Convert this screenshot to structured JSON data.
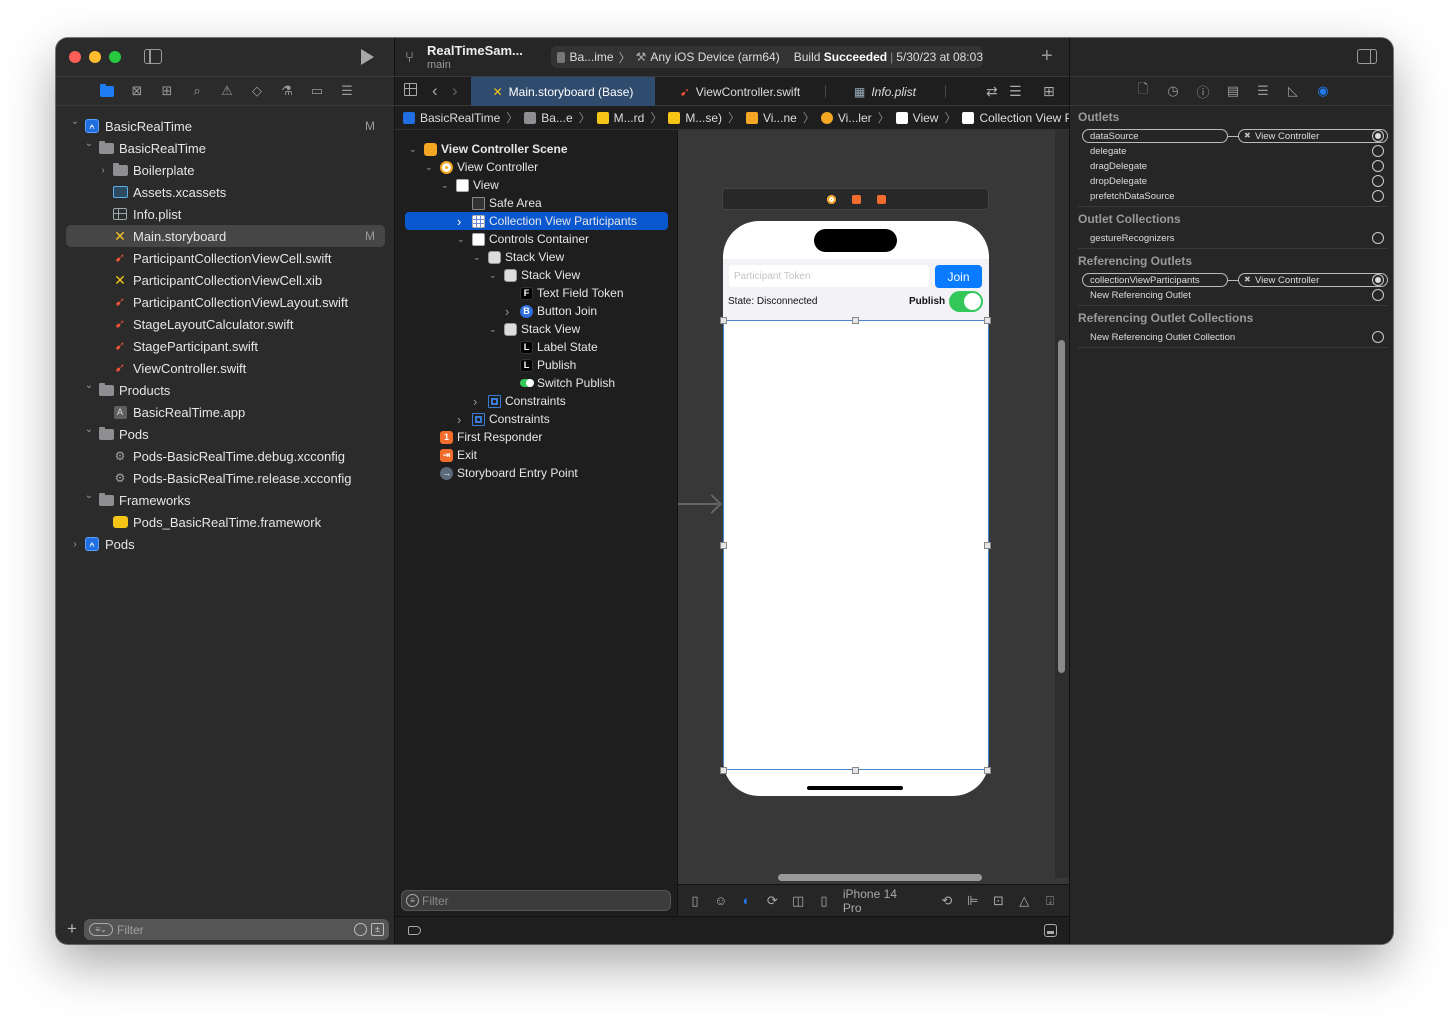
{
  "toolbar": {
    "project_name": "RealTimeSam...",
    "branch": "main",
    "scheme": "Ba...ime",
    "destination": "Any iOS Device (arm64)",
    "status_prefix": "Build",
    "status_bold": "Succeeded",
    "status_time": "5/30/23 at 08:03",
    "add_label": "+"
  },
  "navigator_tabs": [
    "folder-icon",
    "source-control-icon",
    "symbol-icon",
    "find-icon",
    "issue-icon",
    "test-icon",
    "debug-icon",
    "breakpoint-icon",
    "report-icon"
  ],
  "file_tree": [
    {
      "label": "BasicRealTime",
      "icon": "project",
      "level": 0,
      "chevron": "down",
      "badge": "M"
    },
    {
      "label": "BasicRealTime",
      "icon": "folder",
      "level": 1,
      "chevron": "down"
    },
    {
      "label": "Boilerplate",
      "icon": "folder",
      "level": 2,
      "chevron": "right"
    },
    {
      "label": "Assets.xcassets",
      "icon": "assets",
      "level": 2
    },
    {
      "label": "Info.plist",
      "icon": "plist",
      "level": 2
    },
    {
      "label": "Main.storyboard",
      "icon": "storyboard",
      "level": 2,
      "badge": "M",
      "selected": true
    },
    {
      "label": "ParticipantCollectionViewCell.swift",
      "icon": "swift",
      "level": 2
    },
    {
      "label": "ParticipantCollectionViewCell.xib",
      "icon": "storyboard",
      "level": 2
    },
    {
      "label": "ParticipantCollectionViewLayout.swift",
      "icon": "swift",
      "level": 2
    },
    {
      "label": "StageLayoutCalculator.swift",
      "icon": "swift",
      "level": 2
    },
    {
      "label": "StageParticipant.swift",
      "icon": "swift",
      "level": 2
    },
    {
      "label": "ViewController.swift",
      "icon": "swift",
      "level": 2
    },
    {
      "label": "Products",
      "icon": "folder",
      "level": 1,
      "chevron": "down"
    },
    {
      "label": "BasicRealTime.app",
      "icon": "app",
      "level": 2
    },
    {
      "label": "Pods",
      "icon": "folder",
      "level": 1,
      "chevron": "down"
    },
    {
      "label": "Pods-BasicRealTime.debug.xcconfig",
      "icon": "config",
      "level": 2
    },
    {
      "label": "Pods-BasicRealTime.release.xcconfig",
      "icon": "config",
      "level": 2
    },
    {
      "label": "Frameworks",
      "icon": "folder",
      "level": 1,
      "chevron": "down"
    },
    {
      "label": "Pods_BasicRealTime.framework",
      "icon": "framework",
      "level": 2
    },
    {
      "label": "Pods",
      "icon": "project",
      "level": 0,
      "chevron": "right"
    }
  ],
  "navigator_filter": {
    "placeholder": "Filter"
  },
  "tabs": [
    {
      "label": "Main.storyboard (Base)",
      "icon": "storyboard",
      "active": true
    },
    {
      "label": "ViewController.swift",
      "icon": "swift"
    },
    {
      "label": "Info.plist",
      "icon": "plist"
    }
  ],
  "jumpbar": [
    "BasicRealTime",
    "Ba...e",
    "M...rd",
    "M...se)",
    "Vi...ne",
    "Vi...ler",
    "View",
    "Collection View Participants"
  ],
  "outline": [
    {
      "label": "View Controller Scene",
      "icon": "scene",
      "level": 0,
      "chevron": "down",
      "bold": true
    },
    {
      "label": "View Controller",
      "icon": "vc",
      "level": 1,
      "chevron": "down"
    },
    {
      "label": "View",
      "icon": "view",
      "level": 2,
      "chevron": "down"
    },
    {
      "label": "Safe Area",
      "icon": "safe",
      "level": 3
    },
    {
      "label": "Collection View Participants",
      "icon": "collection",
      "level": 3,
      "chevron": "right",
      "selected": true
    },
    {
      "label": "Controls Container",
      "icon": "view",
      "level": 3,
      "chevron": "down"
    },
    {
      "label": "Stack View",
      "icon": "stack",
      "level": 4,
      "chevron": "down"
    },
    {
      "label": "Stack View",
      "icon": "stack",
      "level": 5,
      "chevron": "down"
    },
    {
      "label": "Text Field Token",
      "icon": "textfield",
      "glyph": "F",
      "level": 6
    },
    {
      "label": "Button Join",
      "icon": "button",
      "glyph": "B",
      "level": 6,
      "chevron": "right"
    },
    {
      "label": "Stack View",
      "icon": "stack",
      "level": 5,
      "chevron": "down"
    },
    {
      "label": "Label State",
      "icon": "label",
      "glyph": "L",
      "level": 6
    },
    {
      "label": "Publish",
      "icon": "label",
      "glyph": "L",
      "level": 6
    },
    {
      "label": "Switch Publish",
      "icon": "switch",
      "level": 6
    },
    {
      "label": "Constraints",
      "icon": "constraint",
      "level": 4,
      "chevron": "right"
    },
    {
      "label": "Constraints",
      "icon": "constraint",
      "level": 3,
      "chevron": "right"
    },
    {
      "label": "First Responder",
      "icon": "responder",
      "glyph": "1",
      "level": 1
    },
    {
      "label": "Exit",
      "icon": "exit",
      "glyph": "⇥",
      "level": 1
    },
    {
      "label": "Storyboard Entry Point",
      "icon": "entry",
      "glyph": "→",
      "level": 1
    }
  ],
  "outline_filter": {
    "placeholder": "Filter"
  },
  "canvas": {
    "token_placeholder": "Participant Token",
    "join_label": "Join",
    "state_label": "State: Disconnected",
    "publish_label": "Publish",
    "publish_on": true,
    "device": "iPhone 14 Pro"
  },
  "inspector": {
    "tabs": [
      "file-icon",
      "history-icon",
      "help-icon",
      "identity-icon",
      "attributes-icon",
      "size-icon",
      "connections-icon"
    ],
    "outlets_title": "Outlets",
    "outlets": [
      {
        "name": "dataSource",
        "connected": true,
        "target": "View Controller"
      },
      {
        "name": "delegate",
        "connected": false
      },
      {
        "name": "dragDelegate",
        "connected": false
      },
      {
        "name": "dropDelegate",
        "connected": false
      },
      {
        "name": "prefetchDataSource",
        "connected": false
      }
    ],
    "outlet_collections_title": "Outlet Collections",
    "outlet_collections": [
      {
        "name": "gestureRecognizers",
        "connected": false
      }
    ],
    "referencing_outlets_title": "Referencing Outlets",
    "referencing_outlets": [
      {
        "name": "collectionViewParticipants",
        "connected": true,
        "target": "View Controller"
      },
      {
        "name": "New Referencing Outlet",
        "connected": false
      }
    ],
    "referencing_collections_title": "Referencing Outlet Collections",
    "referencing_collections": [
      {
        "name": "New Referencing Outlet Collection",
        "connected": false
      }
    ]
  },
  "colors": {
    "accent": "#1f7cf4",
    "selection": "#0a58d0",
    "join_button": "#0a7aff",
    "switch_on": "#34c759"
  }
}
